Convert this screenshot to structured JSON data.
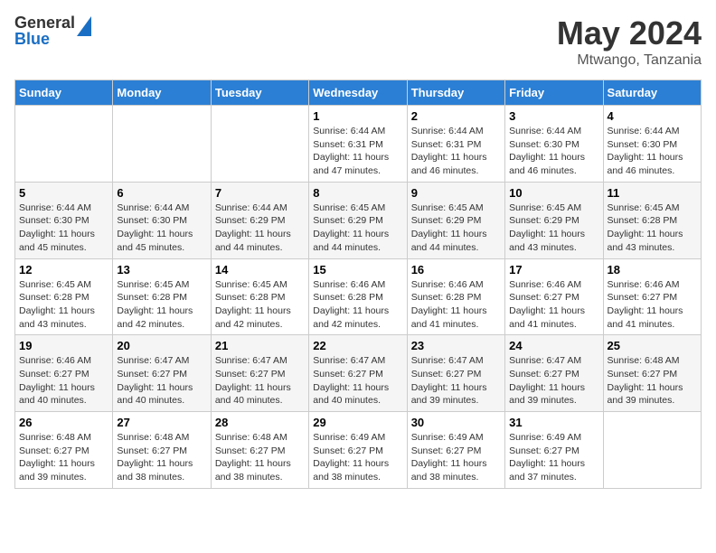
{
  "header": {
    "logo_general": "General",
    "logo_blue": "Blue",
    "month_year": "May 2024",
    "location": "Mtwango, Tanzania"
  },
  "days_of_week": [
    "Sunday",
    "Monday",
    "Tuesday",
    "Wednesday",
    "Thursday",
    "Friday",
    "Saturday"
  ],
  "weeks": [
    [
      {
        "day": "",
        "info": ""
      },
      {
        "day": "",
        "info": ""
      },
      {
        "day": "",
        "info": ""
      },
      {
        "day": "1",
        "info": "Sunrise: 6:44 AM\nSunset: 6:31 PM\nDaylight: 11 hours\nand 47 minutes."
      },
      {
        "day": "2",
        "info": "Sunrise: 6:44 AM\nSunset: 6:31 PM\nDaylight: 11 hours\nand 46 minutes."
      },
      {
        "day": "3",
        "info": "Sunrise: 6:44 AM\nSunset: 6:30 PM\nDaylight: 11 hours\nand 46 minutes."
      },
      {
        "day": "4",
        "info": "Sunrise: 6:44 AM\nSunset: 6:30 PM\nDaylight: 11 hours\nand 46 minutes."
      }
    ],
    [
      {
        "day": "5",
        "info": "Sunrise: 6:44 AM\nSunset: 6:30 PM\nDaylight: 11 hours\nand 45 minutes."
      },
      {
        "day": "6",
        "info": "Sunrise: 6:44 AM\nSunset: 6:30 PM\nDaylight: 11 hours\nand 45 minutes."
      },
      {
        "day": "7",
        "info": "Sunrise: 6:44 AM\nSunset: 6:29 PM\nDaylight: 11 hours\nand 44 minutes."
      },
      {
        "day": "8",
        "info": "Sunrise: 6:45 AM\nSunset: 6:29 PM\nDaylight: 11 hours\nand 44 minutes."
      },
      {
        "day": "9",
        "info": "Sunrise: 6:45 AM\nSunset: 6:29 PM\nDaylight: 11 hours\nand 44 minutes."
      },
      {
        "day": "10",
        "info": "Sunrise: 6:45 AM\nSunset: 6:29 PM\nDaylight: 11 hours\nand 43 minutes."
      },
      {
        "day": "11",
        "info": "Sunrise: 6:45 AM\nSunset: 6:28 PM\nDaylight: 11 hours\nand 43 minutes."
      }
    ],
    [
      {
        "day": "12",
        "info": "Sunrise: 6:45 AM\nSunset: 6:28 PM\nDaylight: 11 hours\nand 43 minutes."
      },
      {
        "day": "13",
        "info": "Sunrise: 6:45 AM\nSunset: 6:28 PM\nDaylight: 11 hours\nand 42 minutes."
      },
      {
        "day": "14",
        "info": "Sunrise: 6:45 AM\nSunset: 6:28 PM\nDaylight: 11 hours\nand 42 minutes."
      },
      {
        "day": "15",
        "info": "Sunrise: 6:46 AM\nSunset: 6:28 PM\nDaylight: 11 hours\nand 42 minutes."
      },
      {
        "day": "16",
        "info": "Sunrise: 6:46 AM\nSunset: 6:28 PM\nDaylight: 11 hours\nand 41 minutes."
      },
      {
        "day": "17",
        "info": "Sunrise: 6:46 AM\nSunset: 6:27 PM\nDaylight: 11 hours\nand 41 minutes."
      },
      {
        "day": "18",
        "info": "Sunrise: 6:46 AM\nSunset: 6:27 PM\nDaylight: 11 hours\nand 41 minutes."
      }
    ],
    [
      {
        "day": "19",
        "info": "Sunrise: 6:46 AM\nSunset: 6:27 PM\nDaylight: 11 hours\nand 40 minutes."
      },
      {
        "day": "20",
        "info": "Sunrise: 6:47 AM\nSunset: 6:27 PM\nDaylight: 11 hours\nand 40 minutes."
      },
      {
        "day": "21",
        "info": "Sunrise: 6:47 AM\nSunset: 6:27 PM\nDaylight: 11 hours\nand 40 minutes."
      },
      {
        "day": "22",
        "info": "Sunrise: 6:47 AM\nSunset: 6:27 PM\nDaylight: 11 hours\nand 40 minutes."
      },
      {
        "day": "23",
        "info": "Sunrise: 6:47 AM\nSunset: 6:27 PM\nDaylight: 11 hours\nand 39 minutes."
      },
      {
        "day": "24",
        "info": "Sunrise: 6:47 AM\nSunset: 6:27 PM\nDaylight: 11 hours\nand 39 minutes."
      },
      {
        "day": "25",
        "info": "Sunrise: 6:48 AM\nSunset: 6:27 PM\nDaylight: 11 hours\nand 39 minutes."
      }
    ],
    [
      {
        "day": "26",
        "info": "Sunrise: 6:48 AM\nSunset: 6:27 PM\nDaylight: 11 hours\nand 39 minutes."
      },
      {
        "day": "27",
        "info": "Sunrise: 6:48 AM\nSunset: 6:27 PM\nDaylight: 11 hours\nand 38 minutes."
      },
      {
        "day": "28",
        "info": "Sunrise: 6:48 AM\nSunset: 6:27 PM\nDaylight: 11 hours\nand 38 minutes."
      },
      {
        "day": "29",
        "info": "Sunrise: 6:49 AM\nSunset: 6:27 PM\nDaylight: 11 hours\nand 38 minutes."
      },
      {
        "day": "30",
        "info": "Sunrise: 6:49 AM\nSunset: 6:27 PM\nDaylight: 11 hours\nand 38 minutes."
      },
      {
        "day": "31",
        "info": "Sunrise: 6:49 AM\nSunset: 6:27 PM\nDaylight: 11 hours\nand 37 minutes."
      },
      {
        "day": "",
        "info": ""
      }
    ]
  ]
}
